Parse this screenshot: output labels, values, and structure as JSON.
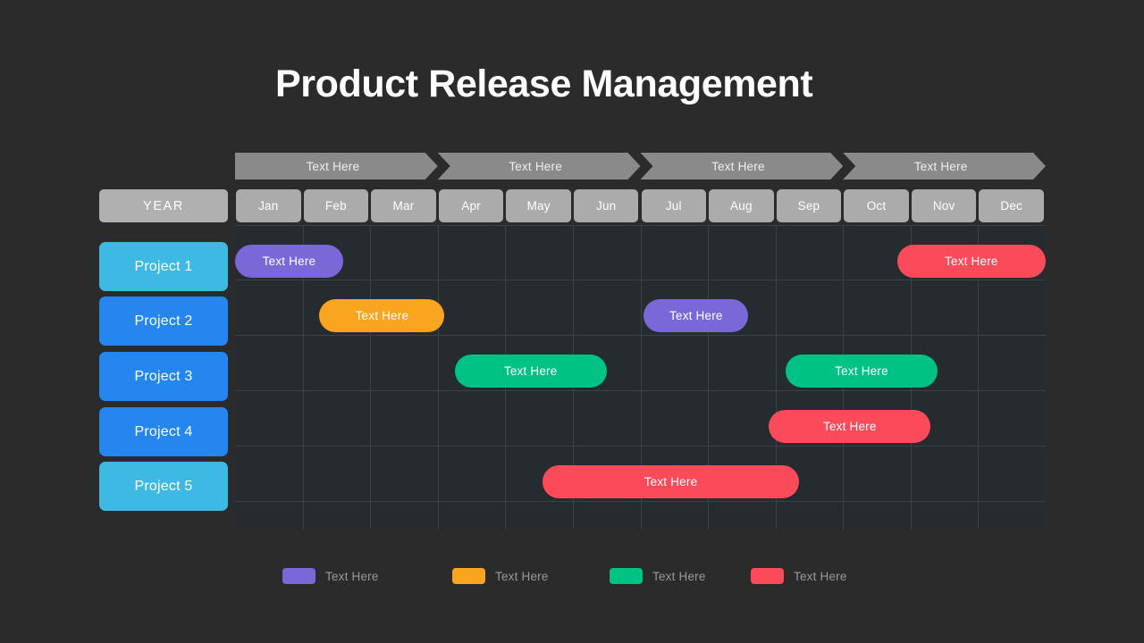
{
  "slide": {
    "title": "Product Release Management",
    "background_color": "#2b2b2b",
    "panel_color": "#262b2f",
    "grid_line_color": "#3b4147"
  },
  "phases": {
    "segment_color": "#8a8a8a",
    "items": [
      {
        "label": "Text Here"
      },
      {
        "label": "Text Here"
      },
      {
        "label": "Text Here"
      },
      {
        "label": "Text Here"
      }
    ]
  },
  "timeline": {
    "year_label": "YEAR",
    "year_color": "#b0b0b0",
    "month_color": "#ababab",
    "months": [
      {
        "label": "Jan"
      },
      {
        "label": "Feb"
      },
      {
        "label": "Mar"
      },
      {
        "label": "Apr"
      },
      {
        "label": "May"
      },
      {
        "label": "Jun"
      },
      {
        "label": "Jul"
      },
      {
        "label": "Aug"
      },
      {
        "label": "Sep"
      },
      {
        "label": "Oct"
      },
      {
        "label": "Nov"
      },
      {
        "label": "Dec"
      }
    ]
  },
  "projects": [
    {
      "label": "Project 1",
      "color": "#3db9e3"
    },
    {
      "label": "Project 2",
      "color": "#2586f0"
    },
    {
      "label": "Project 3",
      "color": "#2586f0"
    },
    {
      "label": "Project 4",
      "color": "#2586f0"
    },
    {
      "label": "Project 5",
      "color": "#3db9e3"
    }
  ],
  "tasks": [
    {
      "label": "Text Here",
      "color": "#7a68d9",
      "row": 1,
      "start_month": 0.0,
      "end_month": 1.6
    },
    {
      "label": "Text Here",
      "color": "#fb4a5a",
      "row": 1,
      "start_month": 9.8,
      "end_month": 12.0
    },
    {
      "label": "Text Here",
      "color": "#f9a51f",
      "row": 2,
      "start_month": 1.25,
      "end_month": 3.1
    },
    {
      "label": "Text Here",
      "color": "#7a68d9",
      "row": 2,
      "start_month": 6.05,
      "end_month": 7.6
    },
    {
      "label": "Text Here",
      "color": "#00c285",
      "row": 3,
      "start_month": 3.25,
      "end_month": 5.5
    },
    {
      "label": "Text Here",
      "color": "#00c285",
      "row": 3,
      "start_month": 8.15,
      "end_month": 10.4
    },
    {
      "label": "Text Here",
      "color": "#fb4a5a",
      "row": 4,
      "start_month": 7.9,
      "end_month": 10.3
    },
    {
      "label": "Text Here",
      "color": "#fb4a5a",
      "row": 5,
      "start_month": 4.55,
      "end_month": 8.35
    }
  ],
  "legend": [
    {
      "label": "Text Here",
      "color": "#7a68d9"
    },
    {
      "label": "Text Here",
      "color": "#f9a51f"
    },
    {
      "label": "Text Here",
      "color": "#00c285"
    },
    {
      "label": "Text Here",
      "color": "#fb4a5a"
    }
  ],
  "chart_data": {
    "type": "bar",
    "subtype": "gantt-timeline",
    "title": "Product Release Management",
    "xlabel": "",
    "ylabel": "",
    "grid": true,
    "legend_position": "bottom",
    "x_categories": [
      "Jan",
      "Feb",
      "Mar",
      "Apr",
      "May",
      "Jun",
      "Jul",
      "Aug",
      "Sep",
      "Oct",
      "Nov",
      "Dec"
    ],
    "y_categories": [
      "Project 1",
      "Project 2",
      "Project 3",
      "Project 4",
      "Project 5"
    ],
    "phase_headers": [
      "Text Here",
      "Text Here",
      "Text Here",
      "Text Here"
    ],
    "phase_spans_months": [
      [
        0,
        3
      ],
      [
        3,
        6
      ],
      [
        6,
        9
      ],
      [
        9,
        12
      ]
    ],
    "series": [
      {
        "name": "Text Here",
        "color": "#7a68d9",
        "bars": [
          {
            "row": "Project 1",
            "label": "Text Here",
            "start_month": 0.0,
            "end_month": 1.6
          },
          {
            "row": "Project 2",
            "label": "Text Here",
            "start_month": 6.05,
            "end_month": 7.6
          }
        ]
      },
      {
        "name": "Text Here",
        "color": "#f9a51f",
        "bars": [
          {
            "row": "Project 2",
            "label": "Text Here",
            "start_month": 1.25,
            "end_month": 3.1
          }
        ]
      },
      {
        "name": "Text Here",
        "color": "#00c285",
        "bars": [
          {
            "row": "Project 3",
            "label": "Text Here",
            "start_month": 3.25,
            "end_month": 5.5
          },
          {
            "row": "Project 3",
            "label": "Text Here",
            "start_month": 8.15,
            "end_month": 10.4
          }
        ]
      },
      {
        "name": "Text Here",
        "color": "#fb4a5a",
        "bars": [
          {
            "row": "Project 1",
            "label": "Text Here",
            "start_month": 9.8,
            "end_month": 12.0
          },
          {
            "row": "Project 4",
            "label": "Text Here",
            "start_month": 7.9,
            "end_month": 10.3
          },
          {
            "row": "Project 5",
            "label": "Text Here",
            "start_month": 4.55,
            "end_month": 8.35
          }
        ]
      }
    ],
    "xlim": [
      0,
      12
    ]
  }
}
